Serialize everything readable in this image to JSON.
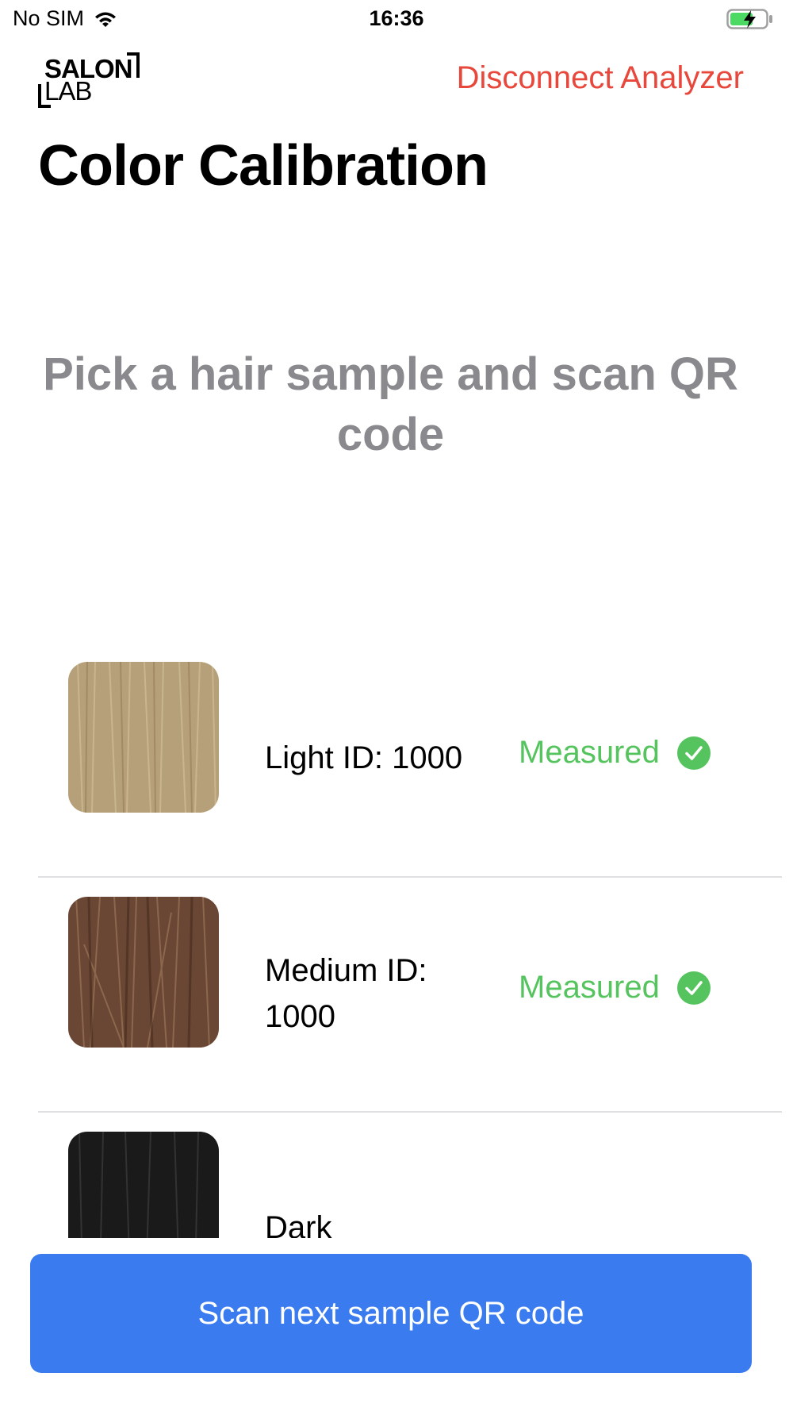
{
  "status_bar": {
    "carrier": "No SIM",
    "time": "16:36",
    "battery_color": "#4cd964"
  },
  "header": {
    "logo_top": "SALON",
    "logo_bottom": "LAB",
    "disconnect_label": "Disconnect Analyzer",
    "title": "Color Calibration"
  },
  "instruction": "Pick a hair sample and scan QR code",
  "samples": [
    {
      "label": "Light ID: 1000",
      "status": "Measured",
      "swatch_color": "#b6a079"
    },
    {
      "label": "Medium ID: 1000",
      "status": "Measured",
      "swatch_color": "#6a4634"
    },
    {
      "label": "Dark",
      "status": "",
      "swatch_color": "#1a1a1a"
    }
  ],
  "scan_button_label": "Scan next sample QR code",
  "colors": {
    "accent_red": "#e8473b",
    "measured_green": "#56c45e",
    "button_blue": "#3a7bf0",
    "instruction_gray": "#8a8a8e"
  }
}
